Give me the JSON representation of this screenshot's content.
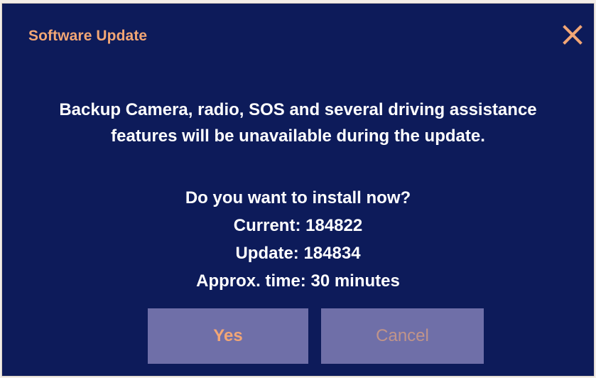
{
  "dialog": {
    "title": "Software Update",
    "close_icon": "close-icon",
    "message_lines": [
      "Backup Camera, radio, SOS and several driving assistance",
      "features will be unavailable during the update."
    ],
    "question": "Do you want to install now?",
    "current": "Current: 184822",
    "update": "Update: 184834",
    "approx_time": "Approx. time: 30 minutes",
    "yes_label": "Yes",
    "cancel_label": "Cancel"
  },
  "colors": {
    "background": "#0d1b5a",
    "accent": "#f2a675",
    "button": "#6f6fa8",
    "text": "#ffffff"
  }
}
